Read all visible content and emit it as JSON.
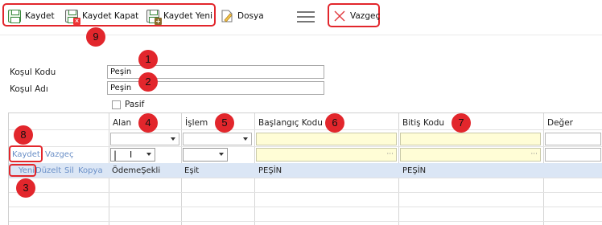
{
  "toolbar": {
    "save_label": "Kaydet",
    "save_close_label": "Kaydet Kapat",
    "save_new_label": "Kaydet Yeni",
    "file_label": "Dosya",
    "cancel_label": "Vazgeç"
  },
  "annotations": [
    "1",
    "2",
    "3",
    "4",
    "5",
    "6",
    "7",
    "8",
    "9"
  ],
  "form": {
    "condition_code_label": "Koşul Kodu",
    "condition_code_value": "Peşin",
    "condition_name_label": "Koşul Adı",
    "condition_name_value": "Peşin",
    "passive_label": "Pasif"
  },
  "grid": {
    "columns": [
      "Alan",
      "İşlem",
      "Başlangıç Kodu",
      "Bitiş Kodu",
      "Değer"
    ],
    "edit_actions": {
      "save": "Kaydet",
      "cancel": "Vazgeç"
    },
    "row_actions": {
      "new": "Yeni",
      "edit": "Düzelt",
      "delete": "Sil",
      "copy": "Kopya"
    },
    "rows": [
      {
        "alan": "ÖdemeŞekli",
        "islem": "Eşit",
        "baslangic": "PEŞİN",
        "bitis": "PEŞİN",
        "deger": ""
      }
    ]
  },
  "colors": {
    "annotation_red": "#e2262c",
    "selected_row": "#dbe6f5",
    "lookup_field": "#fffdd6",
    "link": "#6a8fc7"
  }
}
